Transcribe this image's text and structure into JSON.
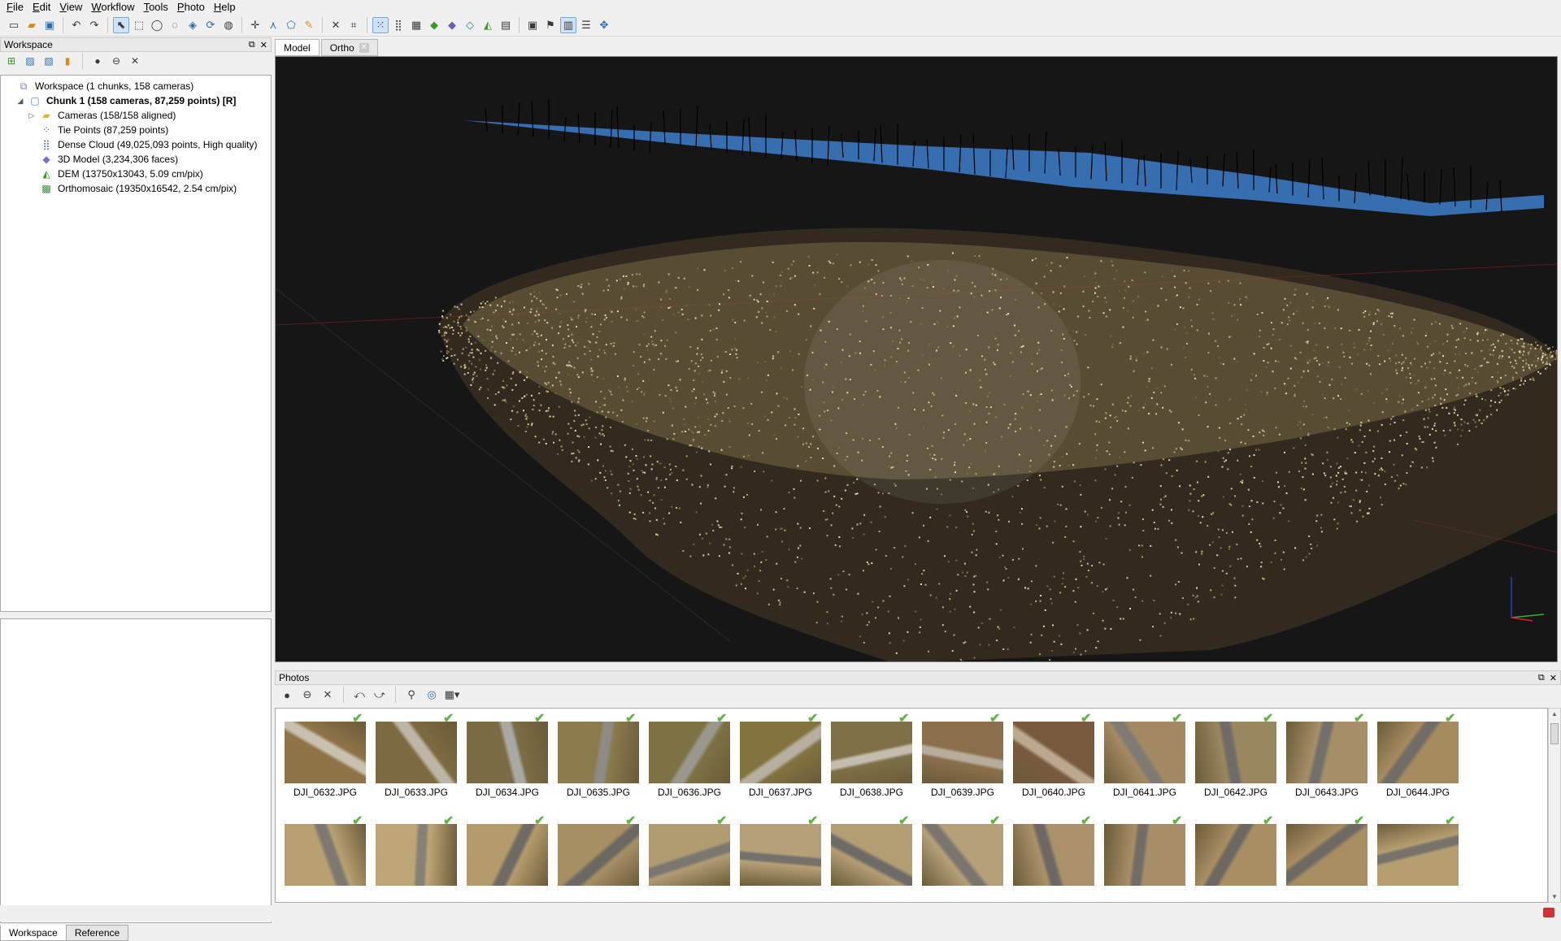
{
  "menu": [
    "File",
    "Edit",
    "View",
    "Workflow",
    "Tools",
    "Photo",
    "Help"
  ],
  "toolbar_icons": [
    "new-icon",
    "open-icon",
    "save-icon",
    "undo-icon",
    "redo-icon",
    "select-icon",
    "rect-select-icon",
    "circle-select-icon",
    "free-select-icon",
    "resize-region-icon",
    "rotate-region-icon",
    "rotate-object-icon",
    "marker-icon",
    "ruler-icon",
    "polygon-icon",
    "measure-icon",
    "delete-icon",
    "crop-icon",
    "point-cloud-icon",
    "dense-cloud-icon",
    "solid-icon",
    "textured-icon",
    "shaded-icon",
    "wireframe-icon",
    "dem-icon",
    "cameras-icon",
    "show-cameras-icon",
    "show-markers-icon",
    "region-icon",
    "navigate-icon"
  ],
  "workspace": {
    "title": "Workspace",
    "tree": [
      {
        "label": "Workspace (1 chunks, 158 cameras)",
        "icon": "workspace-icon",
        "level": 0,
        "expander": ""
      },
      {
        "label": "Chunk 1 (158 cameras, 87,259 points) [R]",
        "icon": "chunk-icon",
        "level": 1,
        "expander": "◢",
        "bold": true
      },
      {
        "label": "Cameras (158/158 aligned)",
        "icon": "folder-icon",
        "level": 2,
        "expander": "▷"
      },
      {
        "label": "Tie Points (87,259 points)",
        "icon": "tie-points-icon",
        "level": 2,
        "expander": ""
      },
      {
        "label": "Dense Cloud (49,025,093 points, High quality)",
        "icon": "dense-cloud-icon",
        "level": 2,
        "expander": ""
      },
      {
        "label": "3D Model (3,234,306 faces)",
        "icon": "model-icon",
        "level": 2,
        "expander": ""
      },
      {
        "label": "DEM (13750x13043, 5.09 cm/pix)",
        "icon": "dem-icon",
        "level": 2,
        "expander": ""
      },
      {
        "label": "Orthomosaic (19350x16542, 2.54 cm/pix)",
        "icon": "orthomosaic-icon",
        "level": 2,
        "expander": ""
      }
    ],
    "bottom_tabs": [
      "Workspace",
      "Reference"
    ]
  },
  "view_tabs": [
    {
      "label": "Model",
      "active": true
    },
    {
      "label": "Ortho",
      "active": false
    }
  ],
  "photos": {
    "title": "Photos",
    "rows": [
      [
        {
          "name": "DJI_0632.JPG",
          "tone": "#8f7448",
          "road": "#c9c1b0"
        },
        {
          "name": "DJI_0633.JPG",
          "tone": "#7e6a40",
          "road": "#bdb6a6"
        },
        {
          "name": "DJI_0634.JPG",
          "tone": "#7c6c45",
          "road": "#a9a9a4"
        },
        {
          "name": "DJI_0635.JPG",
          "tone": "#8a7a4c",
          "road": "#8e8b86"
        },
        {
          "name": "DJI_0636.JPG",
          "tone": "#7d7243",
          "road": "#9a978f"
        },
        {
          "name": "DJI_0637.JPG",
          "tone": "#83733f",
          "road": "#b7b0a0"
        },
        {
          "name": "DJI_0638.JPG",
          "tone": "#7f7047",
          "road": "#c4bdaf"
        },
        {
          "name": "DJI_0639.JPG",
          "tone": "#8b6f4c",
          "road": "#b8ad9c"
        },
        {
          "name": "DJI_0640.JPG",
          "tone": "#7a5a3e",
          "road": "#bba88e"
        },
        {
          "name": "DJI_0641.JPG",
          "tone": "#a48a62",
          "road": "#7f7a74"
        },
        {
          "name": "DJI_0642.JPG",
          "tone": "#9a8760",
          "road": "#6f6b66"
        },
        {
          "name": "DJI_0643.JPG",
          "tone": "#a68f66",
          "road": "#736f6a"
        },
        {
          "name": "DJI_0644.JPG",
          "tone": "#a68b5f",
          "road": "#716c66"
        }
      ],
      [
        {
          "name": "",
          "tone": "#b8a072",
          "road": "#7d7870"
        },
        {
          "name": "",
          "tone": "#bfa677",
          "road": "#868077"
        },
        {
          "name": "",
          "tone": "#b49b6c",
          "road": "#6f6a64"
        },
        {
          "name": "",
          "tone": "#a78f64",
          "road": "#6b6863"
        },
        {
          "name": "",
          "tone": "#b19c72",
          "road": "#7b776f"
        },
        {
          "name": "",
          "tone": "#b6a077",
          "road": "#74706a"
        },
        {
          "name": "",
          "tone": "#b39e74",
          "road": "#6e6b67"
        },
        {
          "name": "",
          "tone": "#b5a079",
          "road": "#7a766f"
        },
        {
          "name": "",
          "tone": "#ab9169",
          "road": "#6d6863"
        },
        {
          "name": "",
          "tone": "#a88e66",
          "road": "#716c66"
        },
        {
          "name": "",
          "tone": "#a98e63",
          "road": "#6c6761"
        },
        {
          "name": "",
          "tone": "#a88d62",
          "road": "#6e6963"
        },
        {
          "name": "",
          "tone": "#b69e70",
          "road": "#77726a"
        }
      ]
    ]
  }
}
